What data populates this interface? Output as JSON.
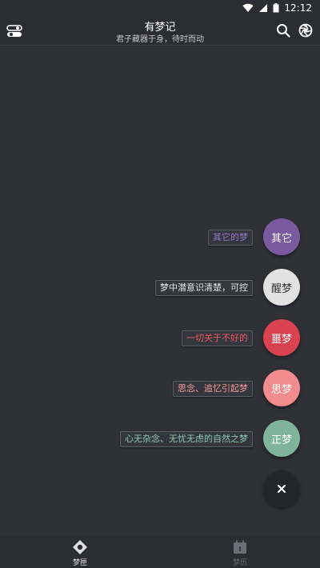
{
  "status": {
    "time": "12:12"
  },
  "header": {
    "title": "有梦记",
    "subtitle": "君子藏器于身，待时而动"
  },
  "fab_menu": [
    {
      "id": "other",
      "label": "其它的梦",
      "button": "其它",
      "color": "#7a5a9e",
      "label_color": "#9b78c9",
      "text_color": "#ffffff"
    },
    {
      "id": "lucid",
      "label": "梦中潜意识清楚，可控",
      "button": "醒梦",
      "color": "#e2e2e2",
      "label_color": "#e8e8e8",
      "text_color": "#333333"
    },
    {
      "id": "nightmare",
      "label": "一切关于不好的",
      "button": "噩梦",
      "color": "#d9434f",
      "label_color": "#f05a63",
      "text_color": "#ffffff"
    },
    {
      "id": "thought",
      "label": "思念、追忆引起梦",
      "button": "思梦",
      "color": "#f28b8b",
      "label_color": "#f79a98",
      "text_color": "#ffffff"
    },
    {
      "id": "normal",
      "label": "心无杂念、无忧无虑的自然之梦",
      "button": "正梦",
      "color": "#7fb39a",
      "label_color": "#8fc8ad",
      "text_color": "#ffffff"
    }
  ],
  "close_icon": "close-icon",
  "bottom_nav": [
    {
      "label": "梦匣",
      "icon": "dream-box-icon",
      "color": "#e0e0e0"
    },
    {
      "label": "梦历",
      "icon": "calendar-icon",
      "color": "#6b6e76"
    }
  ]
}
